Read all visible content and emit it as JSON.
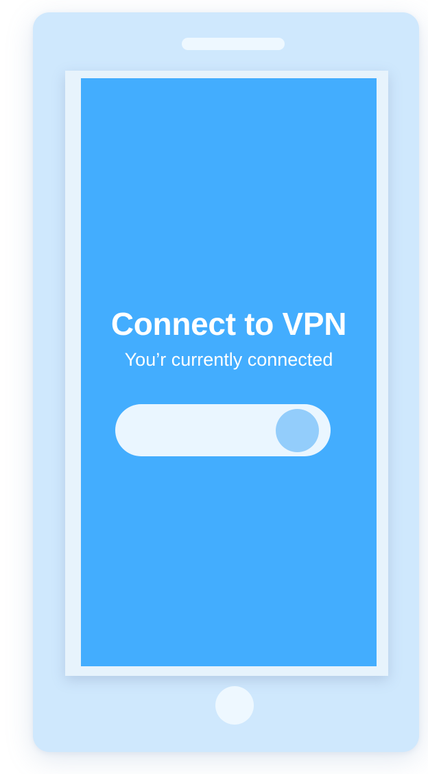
{
  "screen": {
    "title": "Connect to VPN",
    "subtitle": "You’r currently connected"
  },
  "vpn_toggle": {
    "state": "on"
  },
  "colors": {
    "device_body": "#cfe8fd",
    "screen_background": "#43adfe",
    "toggle_track": "#eaf6ff",
    "toggle_knob": "#93cdfb",
    "text": "#ffffff"
  }
}
